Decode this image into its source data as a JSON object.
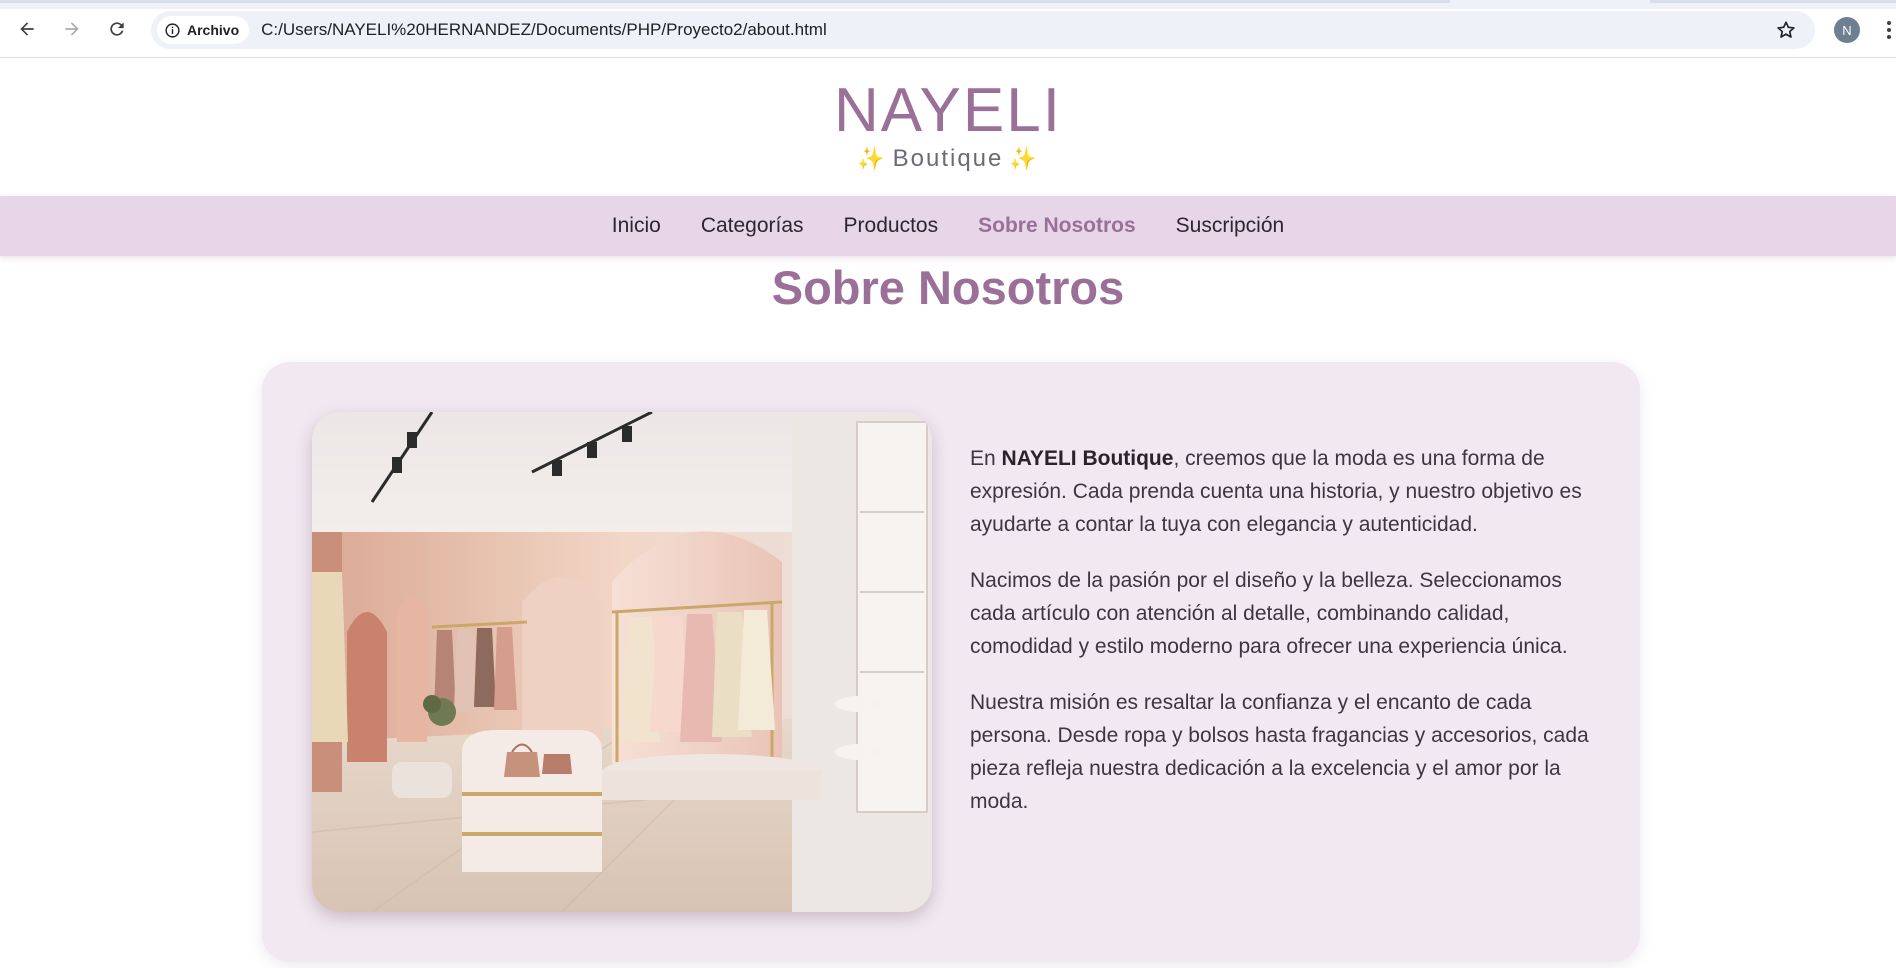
{
  "browser": {
    "site_chip_label": "Archivo",
    "url": "C:/Users/NAYELI%20HERNANDEZ/Documents/PHP/Proyecto2/about.html",
    "profile_initial": "N",
    "icons": [
      "back-arrow-icon",
      "forward-arrow-icon",
      "reload-icon",
      "info-icon",
      "star-icon",
      "kebab-menu-icon"
    ]
  },
  "header": {
    "brand": "NAYELI",
    "tagline": "Boutique",
    "sparkle": "✨"
  },
  "nav": {
    "items": [
      {
        "label": "Inicio",
        "active": false
      },
      {
        "label": "Categorías",
        "active": false
      },
      {
        "label": "Productos",
        "active": false
      },
      {
        "label": "Sobre Nosotros",
        "active": true
      },
      {
        "label": "Suscripción",
        "active": false
      }
    ]
  },
  "about": {
    "title": "Sobre Nosotros",
    "p1_before": "En ",
    "p1_bold": "NAYELI Boutique",
    "p1_after": ", creemos que la moda es una forma de expresión. Cada prenda cuenta una historia, y nuestro objetivo es ayudarte a contar la tuya con elegancia y autenticidad.",
    "p2": "Nacimos de la pasión por el diseño y la belleza. Seleccionamos cada artículo con atención al detalle, combinando calidad, comodidad y estilo moderno para ofrecer una experiencia única.",
    "p3": "Nuestra misión es resaltar la confianza y el encanto de cada persona. Desde ropa y bolsos hasta fragancias y accesorios, cada pieza refleja nuestra dedicación a la excelencia y el amor por la moda."
  },
  "colors": {
    "accent": "#9b7098",
    "nav_bg": "#e6d6e8",
    "card_bg": "#f1e8f1"
  }
}
